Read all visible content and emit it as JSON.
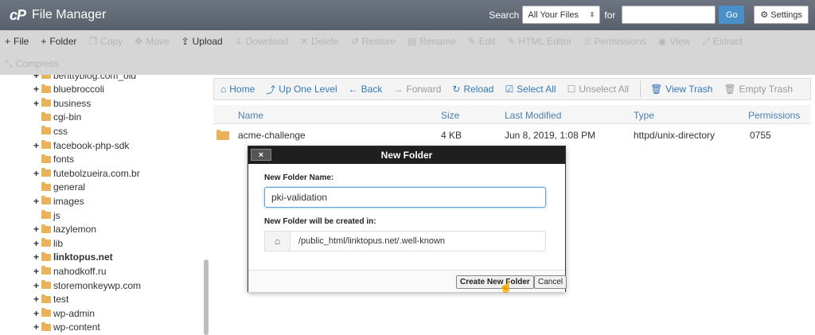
{
  "header": {
    "logo": "cP",
    "title": "File Manager",
    "search_label": "Search",
    "search_scope": "All Your Files",
    "for_label": "for",
    "search_value": "",
    "go_label": "Go",
    "settings_label": "Settings"
  },
  "toolbar": {
    "row1": [
      {
        "icon": "+",
        "label": "File",
        "active": true
      },
      {
        "icon": "+",
        "label": "Folder",
        "active": true
      },
      {
        "icon": "❐",
        "label": "Copy",
        "active": false
      },
      {
        "icon": "✥",
        "label": "Move",
        "active": false
      },
      {
        "icon": "⇪",
        "label": "Upload",
        "active": true
      },
      {
        "icon": "⇩",
        "label": "Download",
        "active": false
      },
      {
        "icon": "✕",
        "label": "Delete",
        "active": false
      },
      {
        "icon": "↺",
        "label": "Restore",
        "active": false
      },
      {
        "icon": "▤",
        "label": "Rename",
        "active": false
      },
      {
        "icon": "✎",
        "label": "Edit",
        "active": false
      },
      {
        "icon": "✎",
        "label": "HTML Editor",
        "active": false
      },
      {
        "icon": "⚿",
        "label": "Permissions",
        "active": false
      },
      {
        "icon": "◉",
        "label": "View",
        "active": false
      },
      {
        "icon": "⤢",
        "label": "Extract",
        "active": false
      }
    ],
    "row2": [
      {
        "icon": "⤡",
        "label": "Compress",
        "active": false
      }
    ]
  },
  "sidebar": {
    "items": [
      {
        "label": "benttyblog.com_old",
        "expand": true,
        "bold": false
      },
      {
        "label": "bluebroccoli",
        "expand": true,
        "bold": false
      },
      {
        "label": "business",
        "expand": true,
        "bold": false
      },
      {
        "label": "cgi-bin",
        "expand": false,
        "bold": false
      },
      {
        "label": "css",
        "expand": false,
        "bold": false
      },
      {
        "label": "facebook-php-sdk",
        "expand": true,
        "bold": false
      },
      {
        "label": "fonts",
        "expand": false,
        "bold": false
      },
      {
        "label": "futebolzueira.com.br",
        "expand": true,
        "bold": false
      },
      {
        "label": "general",
        "expand": false,
        "bold": false
      },
      {
        "label": "images",
        "expand": true,
        "bold": false
      },
      {
        "label": "js",
        "expand": false,
        "bold": false
      },
      {
        "label": "lazylemon",
        "expand": true,
        "bold": false
      },
      {
        "label": "lib",
        "expand": true,
        "bold": false
      },
      {
        "label": "linktopus.net",
        "expand": true,
        "bold": true
      },
      {
        "label": "nahodkoff.ru",
        "expand": true,
        "bold": false
      },
      {
        "label": "storemonkeywp.com",
        "expand": true,
        "bold": false
      },
      {
        "label": "test",
        "expand": true,
        "bold": false
      },
      {
        "label": "wp-admin",
        "expand": true,
        "bold": false
      },
      {
        "label": "wp-content",
        "expand": true,
        "bold": false
      }
    ]
  },
  "nav": {
    "home": "Home",
    "up": "Up One Level",
    "back": "Back",
    "forward": "Forward",
    "reload": "Reload",
    "select_all": "Select All",
    "unselect_all": "Unselect All",
    "view_trash": "View Trash",
    "empty_trash": "Empty Trash"
  },
  "table": {
    "headers": {
      "name": "Name",
      "size": "Size",
      "modified": "Last Modified",
      "type": "Type",
      "perms": "Permissions"
    },
    "rows": [
      {
        "name": "acme-challenge",
        "size": "4 KB",
        "modified": "Jun 8, 2019, 1:08 PM",
        "type": "httpd/unix-directory",
        "perms": "0755"
      }
    ]
  },
  "modal": {
    "title": "New Folder",
    "close_label": "×",
    "name_label": "New Folder Name:",
    "name_value": "pki-validation",
    "location_label": "New Folder will be created in:",
    "location_value": "/public_html/linktopus.net/.well-known",
    "create_label": "Create New Folder",
    "cancel_label": "Cancel"
  }
}
